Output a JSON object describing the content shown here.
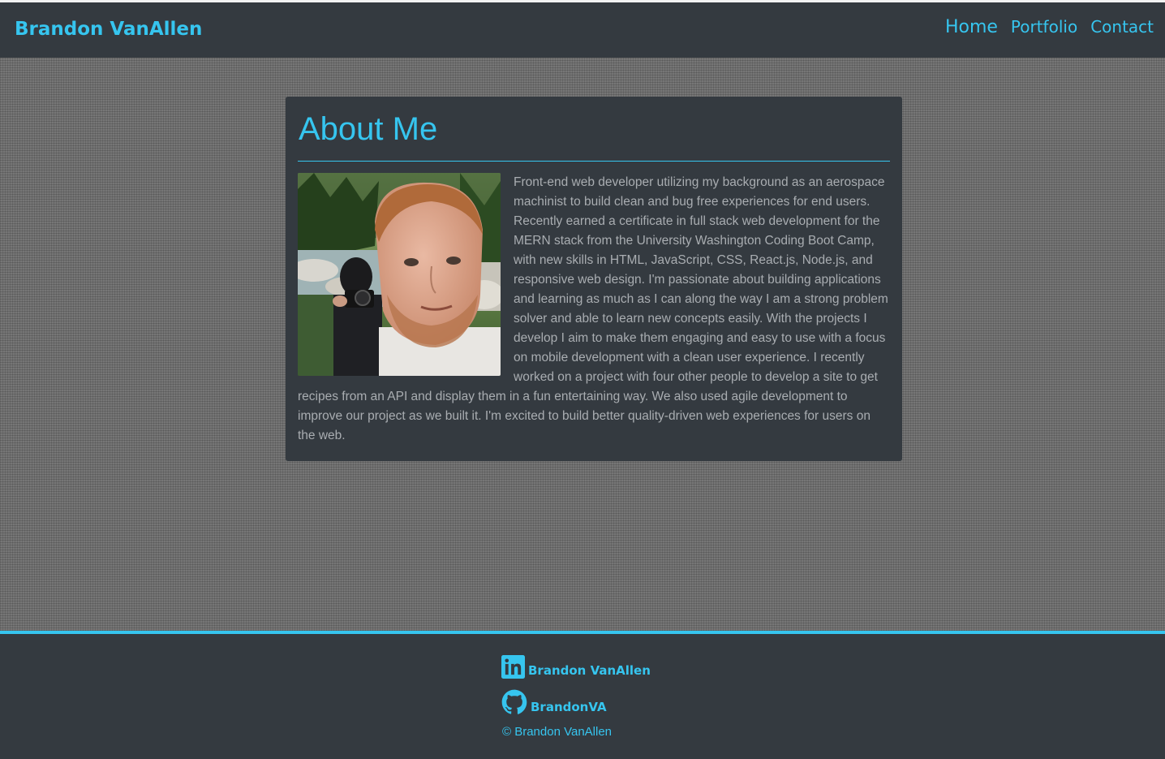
{
  "header": {
    "brand": "Brandon VanAllen",
    "nav": [
      "Home",
      "Portfolio",
      "Contact"
    ]
  },
  "about": {
    "title": "About Me",
    "photo_icon": "profile-photo",
    "text": "Front-end web developer utilizing my background as an aerospace machinist to build clean and bug free experiences for end users. Recently earned a certificate in full stack web development for the MERN stack from the University Washington Coding Boot Camp, with new skills in HTML, JavaScript, CSS, React.js, Node.js, and responsive web design. I'm passionate about building applications and learning as much as I can along the way I am a strong problem solver and able to learn new concepts easily. With the projects I develop I aim to make them engaging and easy to use with a focus on mobile development with a clean user experience. I recently worked on a project with four other people to develop a site to get recipes from an API and display them in a fun entertaining way. We also used agile development to improve our project as we built it. I'm excited to build better quality-driven web experiences for users on the web."
  },
  "footer": {
    "linkedin_label": "Brandon VanAllen",
    "linkedin_icon": "linkedin-icon",
    "github_label": "BrandonVA",
    "github_icon": "github-icon",
    "copyright": "© Brandon VanAllen"
  },
  "colors": {
    "accent": "#36c5ef",
    "panel": "#343a40",
    "text_muted": "#a9adb1"
  }
}
